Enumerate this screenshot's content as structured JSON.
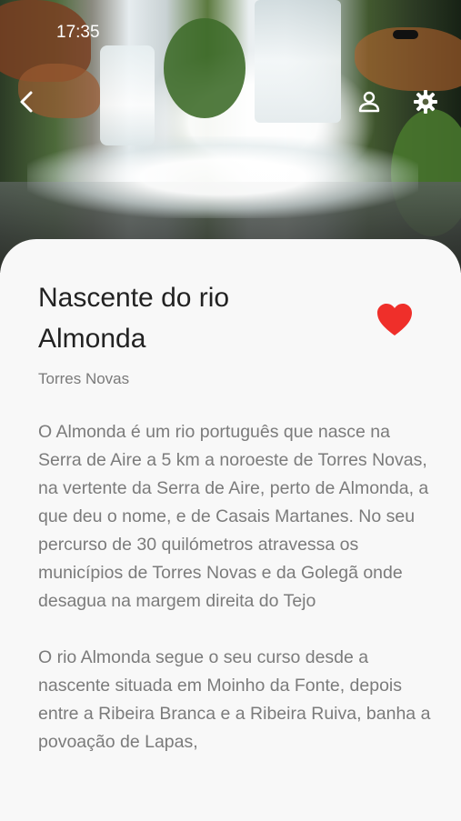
{
  "status_bar": {
    "time": "17:35"
  },
  "header": {
    "back_icon": "chevron-left-icon",
    "profile_icon": "person-icon",
    "settings_icon": "gear-icon"
  },
  "place": {
    "title": "Nascente do rio Almonda",
    "location": "Torres Novas",
    "favorite": true,
    "favorite_color": "#ef2f2a"
  },
  "description": {
    "paragraphs": [
      "O Almonda é um rio português que nasce na Serra de Aire a 5 km a noroeste de Torres Novas, na vertente da Serra de Aire, perto de Almonda, a que deu o nome, e de Casais Martanes. No seu percurso de 30 quilómetros atravessa os municípios de Torres Novas e da Golegã onde desagua na margem direita do Tejo",
      "O rio Almonda segue o seu curso desde a nascente situada em Moinho da Fonte, depois entre a Ribeira Branca e a Ribeira Ruiva, banha a povoação de Lapas,"
    ]
  }
}
